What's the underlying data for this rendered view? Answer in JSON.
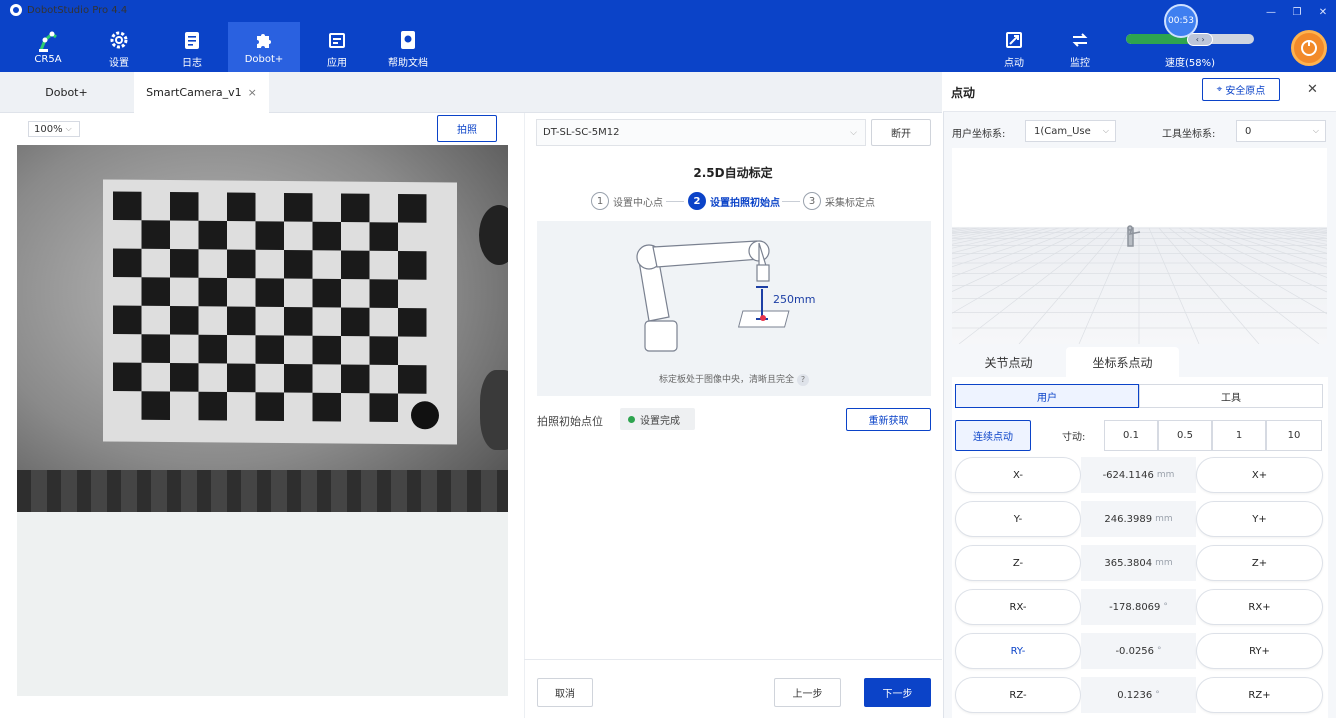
{
  "app": {
    "title": "DobotStudio Pro 4.4"
  },
  "nav": [
    {
      "label": "CR5A",
      "icon": "robot-arm-icon"
    },
    {
      "label": "设置",
      "icon": "gear-icon"
    },
    {
      "label": "日志",
      "icon": "log-icon"
    },
    {
      "label": "Dobot+",
      "icon": "puzzle-icon"
    },
    {
      "label": "应用",
      "icon": "app-icon"
    },
    {
      "label": "帮助文档",
      "icon": "help-doc-icon"
    }
  ],
  "right_nav": [
    {
      "label": "点动",
      "icon": "jog-icon"
    },
    {
      "label": "监控",
      "icon": "monitor-icon"
    }
  ],
  "speed": {
    "label": "速度(58%)",
    "value": 0.58,
    "timer": "00:53"
  },
  "tabs": [
    {
      "label": "Dobot+"
    },
    {
      "label": "SmartCamera_v1",
      "close": "×"
    }
  ],
  "camera": {
    "zoom": "100%",
    "capture_label": "拍照"
  },
  "calib": {
    "device": "DT-SL-SC-5M12",
    "disconnect_label": "断开",
    "title": "2.5D自动标定",
    "steps": [
      {
        "num": "1",
        "label": "设置中心点"
      },
      {
        "num": "2",
        "label": "设置拍照初始点"
      },
      {
        "num": "3",
        "label": "采集标定点"
      }
    ],
    "distance": "250mm",
    "hint": "标定板处于图像中央，清晰且完全",
    "help": "?",
    "init_point_label": "拍照初始点位",
    "status": "设置完成",
    "reacquire_label": "重新获取",
    "cancel_label": "取消",
    "prev_label": "上一步",
    "next_label": "下一步"
  },
  "jog": {
    "title": "点动",
    "safe_origin_label": "安全原点",
    "close": "✕",
    "user_frame_label": "用户坐标系:",
    "user_frame_value": "1(Cam_Use",
    "tool_frame_label": "工具坐标系:",
    "tool_frame_value": "0",
    "tabs": [
      "关节点动",
      "坐标系点动"
    ],
    "modes": [
      "用户",
      "工具"
    ],
    "continuous_label": "连续点动",
    "step_label": "寸动:",
    "steps": [
      "0.1",
      "0.5",
      "1",
      "10"
    ],
    "axes": [
      {
        "minus": "X-",
        "plus": "X+",
        "value": "-624.1146",
        "unit": "mm"
      },
      {
        "minus": "Y-",
        "plus": "Y+",
        "value": "246.3989",
        "unit": "mm"
      },
      {
        "minus": "Z-",
        "plus": "Z+",
        "value": "365.3804",
        "unit": "mm"
      },
      {
        "minus": "RX-",
        "plus": "RX+",
        "value": "-178.8069",
        "unit": "°"
      },
      {
        "minus": "RY-",
        "plus": "RY+",
        "value": "-0.0256",
        "unit": "°"
      },
      {
        "minus": "RZ-",
        "plus": "RZ+",
        "value": "0.1236",
        "unit": "°"
      }
    ]
  }
}
